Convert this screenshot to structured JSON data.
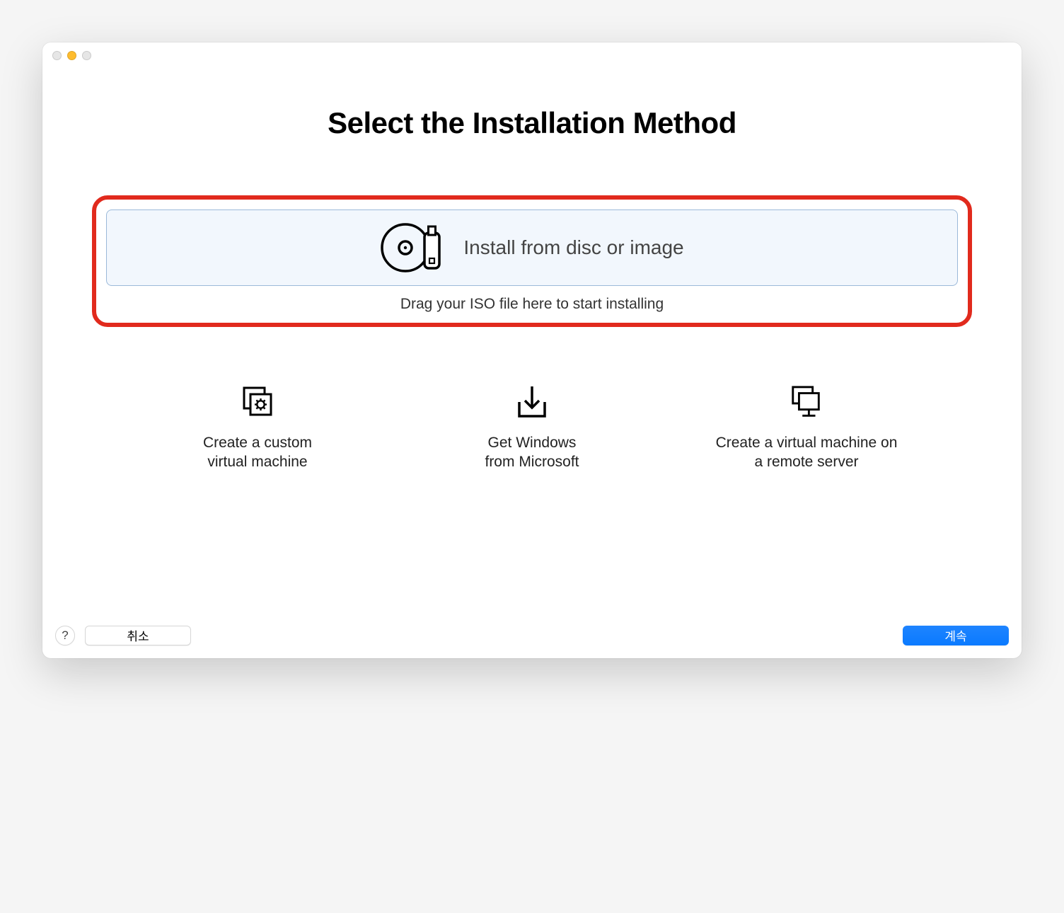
{
  "page": {
    "title": "Select the Installation Method"
  },
  "drop_zone": {
    "label": "Install from disc or image",
    "hint": "Drag your ISO file here to start installing"
  },
  "options": {
    "custom": "Create a custom\nvirtual machine",
    "windows": "Get Windows\nfrom Microsoft",
    "remote": "Create a virtual machine on\na remote server"
  },
  "footer": {
    "help": "?",
    "cancel": "취소",
    "continue": "계속"
  }
}
